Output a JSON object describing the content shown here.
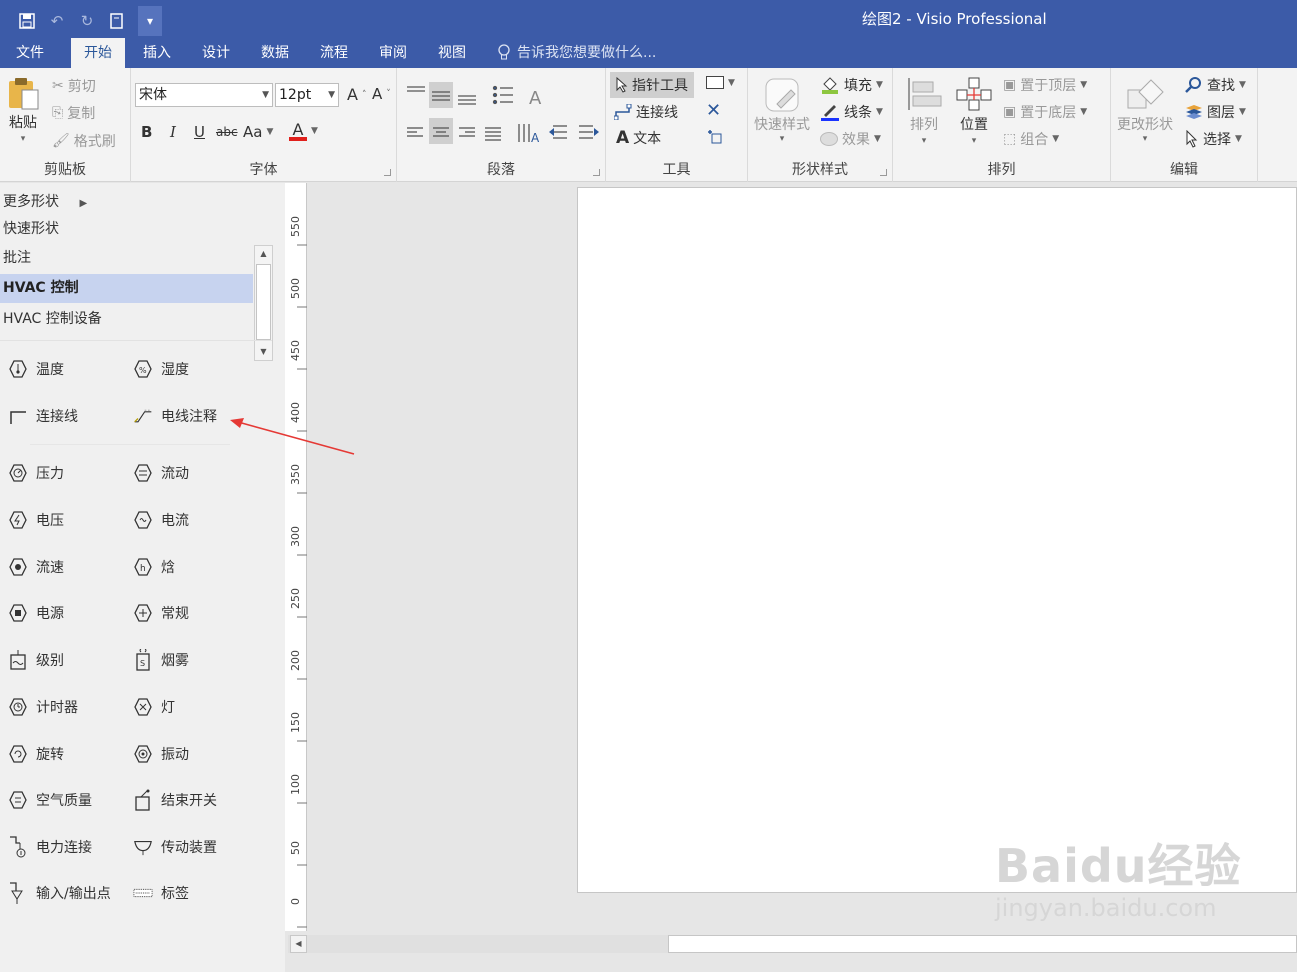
{
  "window": {
    "title": "绘图2 - Visio Professional"
  },
  "qat": {
    "more": "▾"
  },
  "tabs": [
    {
      "label": "文件"
    },
    {
      "label": "开始"
    },
    {
      "label": "插入"
    },
    {
      "label": "设计"
    },
    {
      "label": "数据"
    },
    {
      "label": "流程"
    },
    {
      "label": "审阅"
    },
    {
      "label": "视图"
    }
  ],
  "tellme": {
    "text": "告诉我您想要做什么..."
  },
  "ribbon": {
    "clipboard": {
      "label": "剪贴板",
      "paste": "粘贴",
      "cut": "剪切",
      "copy": "复制",
      "format_painter": "格式刷"
    },
    "font": {
      "label": "字体",
      "font_name": "宋体",
      "font_size": "12pt",
      "bold": "B",
      "italic": "I",
      "underline": "U",
      "strike": "abc",
      "case": "Aa",
      "color_letter": "A",
      "grow": "A",
      "shrink": "A"
    },
    "paragraph": {
      "label": "段落"
    },
    "tools": {
      "label": "工具",
      "pointer": "指针工具",
      "connector": "连接线",
      "text": "文本",
      "text_icon": "A"
    },
    "shape_styles": {
      "label": "形状样式",
      "quick_styles": "快速样式",
      "fill": "填充",
      "line": "线条",
      "effects": "效果"
    },
    "arrange": {
      "label": "排列",
      "align": "排列",
      "position": "位置",
      "bring_front": "置于顶层",
      "send_back": "置于底层",
      "group": "组合"
    },
    "editing": {
      "label": "编辑",
      "change_shape": "更改形状",
      "find": "查找",
      "layers": "图层",
      "select": "选择"
    }
  },
  "shapes_panel": {
    "more_shapes": "更多形状",
    "stencils": [
      {
        "label": "快速形状"
      },
      {
        "label": "批注"
      },
      {
        "label": "HVAC 控制"
      },
      {
        "label": "HVAC 控制设备"
      }
    ],
    "shapes": [
      {
        "label": "温度"
      },
      {
        "label": "湿度"
      },
      {
        "label": "连接线"
      },
      {
        "label": "电线注释"
      },
      {
        "label": "压力"
      },
      {
        "label": "流动"
      },
      {
        "label": "电压"
      },
      {
        "label": "电流"
      },
      {
        "label": "流速"
      },
      {
        "label": "焓"
      },
      {
        "label": "电源"
      },
      {
        "label": "常规"
      },
      {
        "label": "级别"
      },
      {
        "label": "烟雾"
      },
      {
        "label": "计时器"
      },
      {
        "label": "灯"
      },
      {
        "label": "旋转"
      },
      {
        "label": "振动"
      },
      {
        "label": "空气质量"
      },
      {
        "label": "结束开关"
      },
      {
        "label": "电力连接"
      },
      {
        "label": "传动装置"
      },
      {
        "label": "输入/输出点"
      },
      {
        "label": "标签"
      }
    ]
  },
  "ruler": {
    "labels": [
      "550",
      "500",
      "450",
      "400",
      "350",
      "300",
      "250",
      "200",
      "150",
      "100",
      "50",
      "0"
    ]
  },
  "watermark": {
    "line1": "Baidu经验",
    "line2": "jingyan.baidu.com"
  },
  "colors": {
    "titlebar": "#3c5ba8",
    "active_tab_text": "#2b579a",
    "selected_stencil": "#c7d3ef",
    "annotation_arrow": "#e53935"
  }
}
